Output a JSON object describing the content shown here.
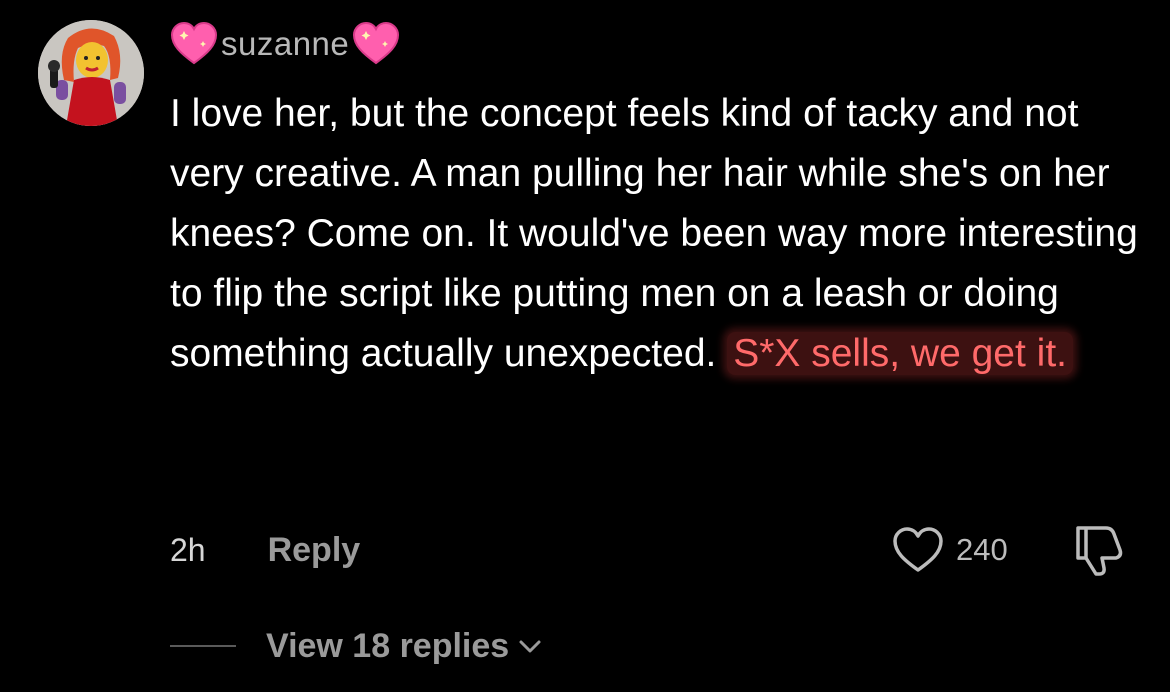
{
  "comment": {
    "username": "suzanne",
    "username_emoji_left": "sparkling-heart",
    "username_emoji_right": "sparkling-heart",
    "body_text": "I love her, but the concept feels kind of tacky and not very creative. A man pulling her hair while she's on her knees? Come on. It would've been way more interesting to flip the script like putting men on a leash or doing something actually unexpected. ",
    "body_highlight": "S*X sells, we get it.",
    "timestamp": "2h",
    "reply_label": "Reply",
    "like_count": "240",
    "view_replies_label": "View 18 replies"
  },
  "colors": {
    "background": "#000000",
    "text": "#ffffff",
    "muted": "#9a9a9a",
    "highlight_text": "#ff6a6a",
    "highlight_bg": "#dc3c3c"
  },
  "icons": {
    "like": "heart-outline-icon",
    "dislike": "thumbs-down-outline-icon",
    "expand": "chevron-down-icon"
  }
}
